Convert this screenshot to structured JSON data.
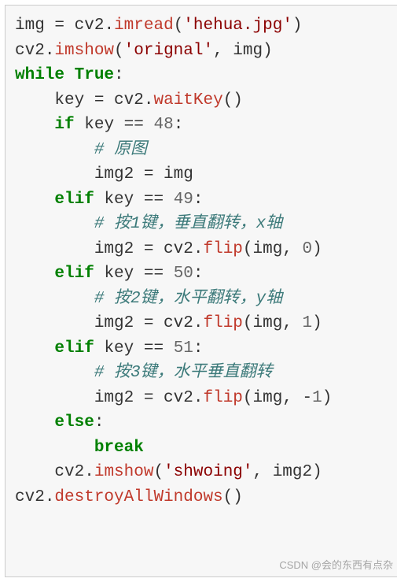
{
  "code": {
    "lines": [
      {
        "indent": 0,
        "tokens": [
          {
            "t": "img ",
            "c": "default"
          },
          {
            "t": "=",
            "c": "default"
          },
          {
            "t": " cv2",
            "c": "default"
          },
          {
            "t": ".",
            "c": "default"
          },
          {
            "t": "imread",
            "c": "func"
          },
          {
            "t": "(",
            "c": "default"
          },
          {
            "t": "'hehua.jpg'",
            "c": "string"
          },
          {
            "t": ")",
            "c": "default"
          }
        ]
      },
      {
        "indent": 0,
        "tokens": [
          {
            "t": "cv2",
            "c": "default"
          },
          {
            "t": ".",
            "c": "default"
          },
          {
            "t": "imshow",
            "c": "func"
          },
          {
            "t": "(",
            "c": "default"
          },
          {
            "t": "'orignal'",
            "c": "string"
          },
          {
            "t": ", img)",
            "c": "default"
          }
        ]
      },
      {
        "indent": 0,
        "tokens": [
          {
            "t": "while",
            "c": "keyword"
          },
          {
            "t": " ",
            "c": "default"
          },
          {
            "t": "True",
            "c": "const"
          },
          {
            "t": ":",
            "c": "default"
          }
        ]
      },
      {
        "indent": 1,
        "tokens": [
          {
            "t": "key ",
            "c": "default"
          },
          {
            "t": "=",
            "c": "default"
          },
          {
            "t": " cv2",
            "c": "default"
          },
          {
            "t": ".",
            "c": "default"
          },
          {
            "t": "waitKey",
            "c": "func"
          },
          {
            "t": "()",
            "c": "default"
          }
        ]
      },
      {
        "indent": 1,
        "tokens": [
          {
            "t": "if",
            "c": "keyword"
          },
          {
            "t": " key ",
            "c": "default"
          },
          {
            "t": "==",
            "c": "default"
          },
          {
            "t": " ",
            "c": "default"
          },
          {
            "t": "48",
            "c": "number"
          },
          {
            "t": ":",
            "c": "default"
          }
        ]
      },
      {
        "indent": 2,
        "tokens": [
          {
            "t": "# 原图",
            "c": "comment"
          }
        ]
      },
      {
        "indent": 2,
        "tokens": [
          {
            "t": "img2 ",
            "c": "default"
          },
          {
            "t": "=",
            "c": "default"
          },
          {
            "t": " img",
            "c": "default"
          }
        ]
      },
      {
        "indent": 1,
        "tokens": [
          {
            "t": "elif",
            "c": "keyword"
          },
          {
            "t": " key ",
            "c": "default"
          },
          {
            "t": "==",
            "c": "default"
          },
          {
            "t": " ",
            "c": "default"
          },
          {
            "t": "49",
            "c": "number"
          },
          {
            "t": ":",
            "c": "default"
          }
        ]
      },
      {
        "indent": 2,
        "tokens": [
          {
            "t": "# 按1键，垂直翻转，x轴",
            "c": "comment"
          }
        ]
      },
      {
        "indent": 2,
        "tokens": [
          {
            "t": "img2 ",
            "c": "default"
          },
          {
            "t": "=",
            "c": "default"
          },
          {
            "t": " cv2",
            "c": "default"
          },
          {
            "t": ".",
            "c": "default"
          },
          {
            "t": "flip",
            "c": "func"
          },
          {
            "t": "(img, ",
            "c": "default"
          },
          {
            "t": "0",
            "c": "number"
          },
          {
            "t": ")",
            "c": "default"
          }
        ]
      },
      {
        "indent": 1,
        "tokens": [
          {
            "t": "elif",
            "c": "keyword"
          },
          {
            "t": " key ",
            "c": "default"
          },
          {
            "t": "==",
            "c": "default"
          },
          {
            "t": " ",
            "c": "default"
          },
          {
            "t": "50",
            "c": "number"
          },
          {
            "t": ":",
            "c": "default"
          }
        ]
      },
      {
        "indent": 2,
        "tokens": [
          {
            "t": "# 按2键，水平翻转，y轴",
            "c": "comment"
          }
        ]
      },
      {
        "indent": 2,
        "tokens": [
          {
            "t": "img2 ",
            "c": "default"
          },
          {
            "t": "=",
            "c": "default"
          },
          {
            "t": " cv2",
            "c": "default"
          },
          {
            "t": ".",
            "c": "default"
          },
          {
            "t": "flip",
            "c": "func"
          },
          {
            "t": "(img, ",
            "c": "default"
          },
          {
            "t": "1",
            "c": "number"
          },
          {
            "t": ")",
            "c": "default"
          }
        ]
      },
      {
        "indent": 1,
        "tokens": [
          {
            "t": "elif",
            "c": "keyword"
          },
          {
            "t": " key ",
            "c": "default"
          },
          {
            "t": "==",
            "c": "default"
          },
          {
            "t": " ",
            "c": "default"
          },
          {
            "t": "51",
            "c": "number"
          },
          {
            "t": ":",
            "c": "default"
          }
        ]
      },
      {
        "indent": 2,
        "tokens": [
          {
            "t": "# 按3键，水平垂直翻转",
            "c": "comment"
          }
        ]
      },
      {
        "indent": 2,
        "tokens": [
          {
            "t": "img2 ",
            "c": "default"
          },
          {
            "t": "=",
            "c": "default"
          },
          {
            "t": " cv2",
            "c": "default"
          },
          {
            "t": ".",
            "c": "default"
          },
          {
            "t": "flip",
            "c": "func"
          },
          {
            "t": "(img, ",
            "c": "default"
          },
          {
            "t": "-",
            "c": "default"
          },
          {
            "t": "1",
            "c": "number"
          },
          {
            "t": ")",
            "c": "default"
          }
        ]
      },
      {
        "indent": 1,
        "tokens": [
          {
            "t": "else",
            "c": "keyword"
          },
          {
            "t": ":",
            "c": "default"
          }
        ]
      },
      {
        "indent": 2,
        "tokens": [
          {
            "t": "break",
            "c": "keyword"
          }
        ]
      },
      {
        "indent": 1,
        "tokens": [
          {
            "t": "cv2",
            "c": "default"
          },
          {
            "t": ".",
            "c": "default"
          },
          {
            "t": "imshow",
            "c": "func"
          },
          {
            "t": "(",
            "c": "default"
          },
          {
            "t": "'shwoing'",
            "c": "string"
          },
          {
            "t": ", img2)",
            "c": "default"
          }
        ]
      },
      {
        "indent": 0,
        "tokens": [
          {
            "t": "cv2",
            "c": "default"
          },
          {
            "t": ".",
            "c": "default"
          },
          {
            "t": "destroyAllWindows",
            "c": "func"
          },
          {
            "t": "()",
            "c": "default"
          }
        ]
      }
    ]
  },
  "watermark": "CSDN @会的东西有点杂"
}
